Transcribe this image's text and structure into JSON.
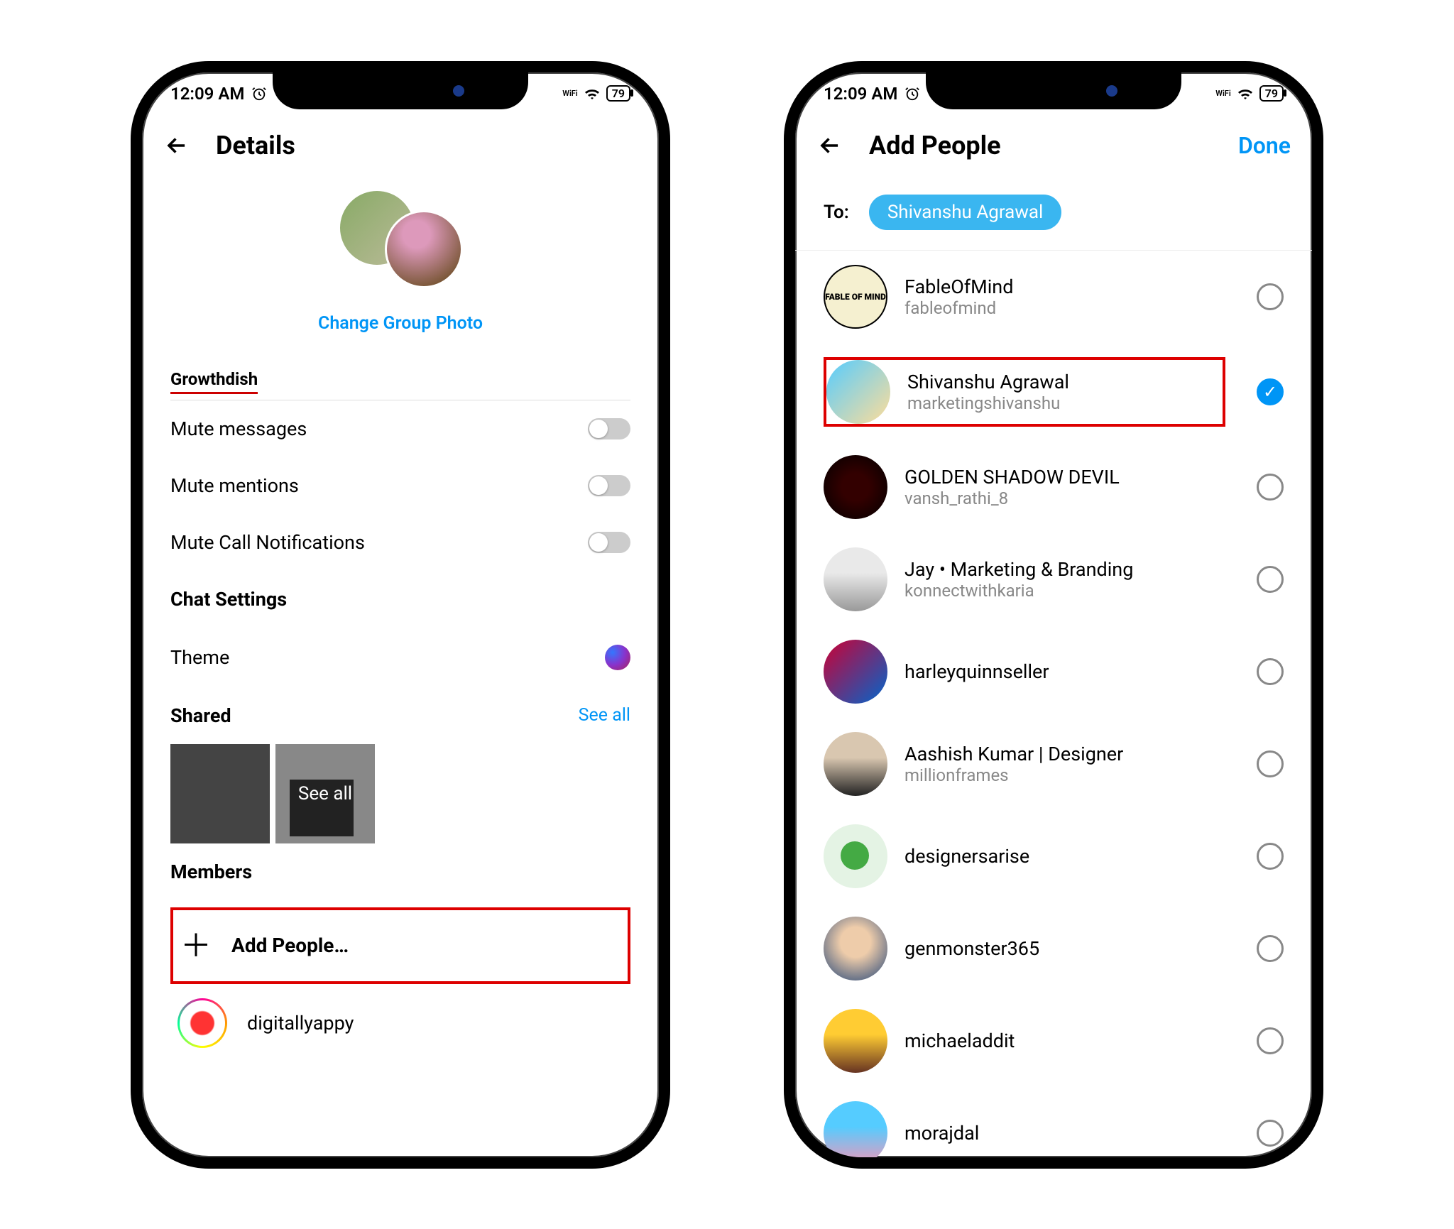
{
  "status": {
    "time": "12:09 AM",
    "wifi": "WiFi",
    "battery": "79"
  },
  "details": {
    "title": "Details",
    "change_photo": "Change Group Photo",
    "group_name": "Growthdish",
    "settings": {
      "mute_messages": "Mute messages",
      "mute_mentions": "Mute mentions",
      "mute_calls": "Mute Call Notifications",
      "chat_settings": "Chat Settings",
      "theme": "Theme"
    },
    "shared": {
      "title": "Shared",
      "see_all": "See all",
      "overlay": "See all"
    },
    "members": {
      "title": "Members",
      "add_people": "Add People…"
    },
    "existing_member": "digitallyappy"
  },
  "add_people": {
    "title": "Add People",
    "done": "Done",
    "to_label": "To:",
    "chip": "Shivanshu Agrawal",
    "list": [
      {
        "name": "FableOfMind",
        "handle": "fableofmind",
        "avatar": "av-fable",
        "selected": false
      },
      {
        "name": "Shivanshu Agrawal",
        "handle": "marketingshivanshu",
        "avatar": "av-shiv",
        "selected": true,
        "highlighted": true
      },
      {
        "name": "GOLDEN SHADOW DEVIL",
        "handle": "vansh_rathi_8",
        "avatar": "av-golden",
        "selected": false
      },
      {
        "name": "Jay • Marketing & Branding",
        "handle": "konnectwithkaria",
        "avatar": "av-jay",
        "selected": false
      },
      {
        "name": "harleyquinnseller",
        "handle": "",
        "avatar": "av-harley",
        "selected": false
      },
      {
        "name": "Aashish Kumar | Designer",
        "handle": "millionframes",
        "avatar": "av-aashish",
        "selected": false
      },
      {
        "name": "designersarise",
        "handle": "",
        "avatar": "av-designers",
        "selected": false
      },
      {
        "name": "genmonster365",
        "handle": "",
        "avatar": "av-gen",
        "selected": false
      },
      {
        "name": "michaeladdit",
        "handle": "",
        "avatar": "av-michael",
        "selected": false
      },
      {
        "name": "morajdal",
        "handle": "",
        "avatar": "av-moraj",
        "selected": false
      }
    ]
  }
}
